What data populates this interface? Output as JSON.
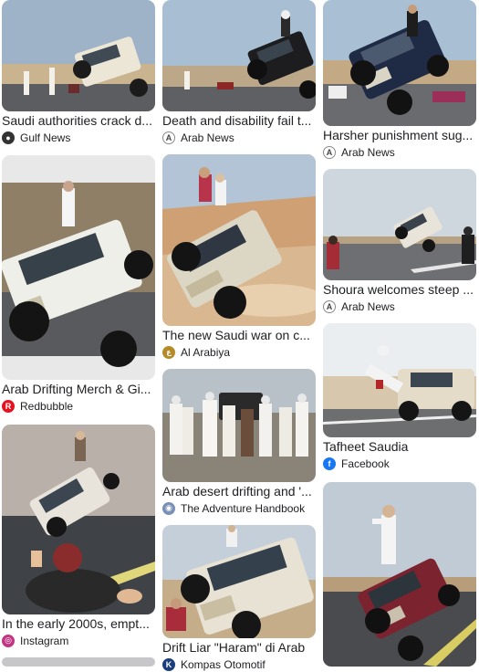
{
  "results": {
    "col1": [
      {
        "title": "Saudi authorities crack d...",
        "source": "Gulf News",
        "icon": "gulf-news-icon",
        "color": "#333333"
      },
      {
        "title": "Arab Drifting Merch & Gi...",
        "source": "Redbubble",
        "icon": "redbubble-icon",
        "color": "#e41321"
      },
      {
        "title": "In the early 2000s, empt...",
        "source": "Instagram",
        "icon": "instagram-icon",
        "color": "#c13584"
      }
    ],
    "col2": [
      {
        "title": "Death and disability fail t...",
        "source": "Arab News",
        "icon": "arab-news-icon",
        "color": "#555555"
      },
      {
        "title": "The new Saudi war on c...",
        "source": "Al Arabiya",
        "icon": "al-arabiya-icon",
        "color": "#b58b2a"
      },
      {
        "title": "Arab desert drifting and '...",
        "source": "The Adventure Handbook",
        "icon": "adventure-handbook-icon",
        "color": "#7a8fb5"
      },
      {
        "title": "Drift Liar \"Haram\" di Arab",
        "source": "Kompas Otomotif",
        "icon": "kompas-icon",
        "color": "#1a3d7c"
      }
    ],
    "col3": [
      {
        "title": "Harsher punishment sug...",
        "source": "Arab News",
        "icon": "arab-news-icon",
        "color": "#555555"
      },
      {
        "title": "Shoura welcomes steep ...",
        "source": "Arab News",
        "icon": "arab-news-icon",
        "color": "#555555"
      },
      {
        "title": "Tafheet Saudia",
        "source": "Facebook",
        "icon": "facebook-icon",
        "color": "#1877f2"
      },
      {
        "title": "",
        "source": "",
        "icon": "",
        "color": "#ffffff"
      }
    ]
  }
}
